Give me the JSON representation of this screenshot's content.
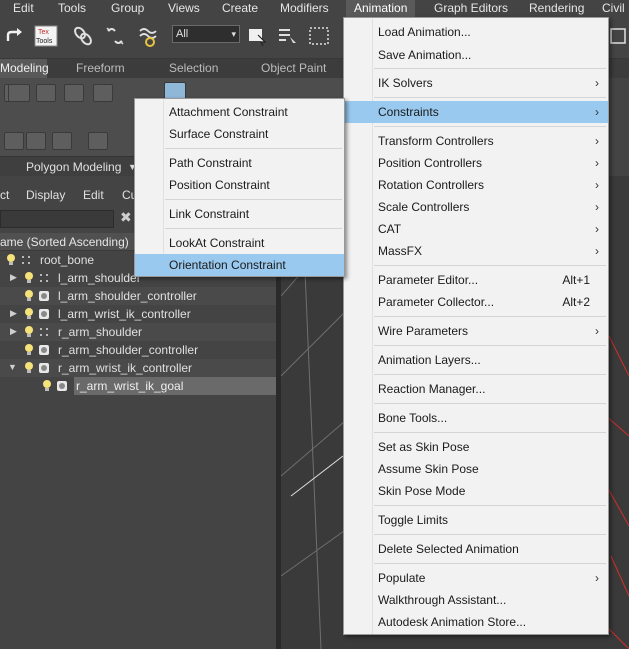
{
  "menubar": {
    "items": [
      "Edit",
      "Tools",
      "Group",
      "Views",
      "Create",
      "Modifiers",
      "Animation",
      "Graph Editors",
      "Rendering",
      "Civil"
    ]
  },
  "toolbar": {
    "selection_filter": "All"
  },
  "ribbon": {
    "tabs": [
      "Modeling",
      "Freeform",
      "Selection",
      "Object Paint"
    ],
    "panel_label": "Polygon Modeling"
  },
  "explorer": {
    "menu": [
      "ct",
      "Display",
      "Edit",
      "Cu"
    ],
    "column_header": "ame (Sorted Ascending)",
    "rows": [
      {
        "label": "root_bone",
        "depth": 0
      },
      {
        "label": "l_arm_shoulder",
        "depth": 1
      },
      {
        "label": "l_arm_shoulder_controller",
        "depth": 1
      },
      {
        "label": "l_arm_wrist_ik_controller",
        "depth": 1
      },
      {
        "label": "r_arm_shoulder",
        "depth": 1
      },
      {
        "label": "r_arm_shoulder_controller",
        "depth": 1
      },
      {
        "label": "r_arm_wrist_ik_controller",
        "depth": 1
      },
      {
        "label": "r_arm_wrist_ik_goal",
        "depth": 2
      }
    ]
  },
  "animation_menu": {
    "items": [
      {
        "label": "Load Animation..."
      },
      {
        "label": "Save Animation..."
      },
      {
        "label": "IK Solvers"
      },
      {
        "label": "Constraints"
      },
      {
        "label": "Transform Controllers"
      },
      {
        "label": "Position Controllers"
      },
      {
        "label": "Rotation Controllers"
      },
      {
        "label": "Scale Controllers"
      },
      {
        "label": "CAT"
      },
      {
        "label": "MassFX"
      },
      {
        "label": "Parameter Editor...",
        "shortcut": "Alt+1"
      },
      {
        "label": "Parameter Collector...",
        "shortcut": "Alt+2"
      },
      {
        "label": "Wire Parameters"
      },
      {
        "label": "Animation Layers..."
      },
      {
        "label": "Reaction Manager..."
      },
      {
        "label": "Bone Tools..."
      },
      {
        "label": "Set as Skin Pose"
      },
      {
        "label": "Assume Skin Pose"
      },
      {
        "label": "Skin Pose Mode"
      },
      {
        "label": "Toggle Limits"
      },
      {
        "label": "Delete Selected Animation"
      },
      {
        "label": "Populate"
      },
      {
        "label": "Walkthrough Assistant..."
      },
      {
        "label": "Autodesk Animation Store..."
      }
    ]
  },
  "constraints_menu": {
    "items": [
      {
        "label": "Attachment Constraint"
      },
      {
        "label": "Surface Constraint"
      },
      {
        "label": "Path Constraint"
      },
      {
        "label": "Position Constraint"
      },
      {
        "label": "Link Constraint"
      },
      {
        "label": "LookAt Constraint"
      },
      {
        "label": "Orientation Constraint"
      }
    ]
  },
  "colors": {
    "menu_highlight": "#99c9ef",
    "menu_background": "#f2f2f2",
    "ui_dark": "#444444"
  }
}
